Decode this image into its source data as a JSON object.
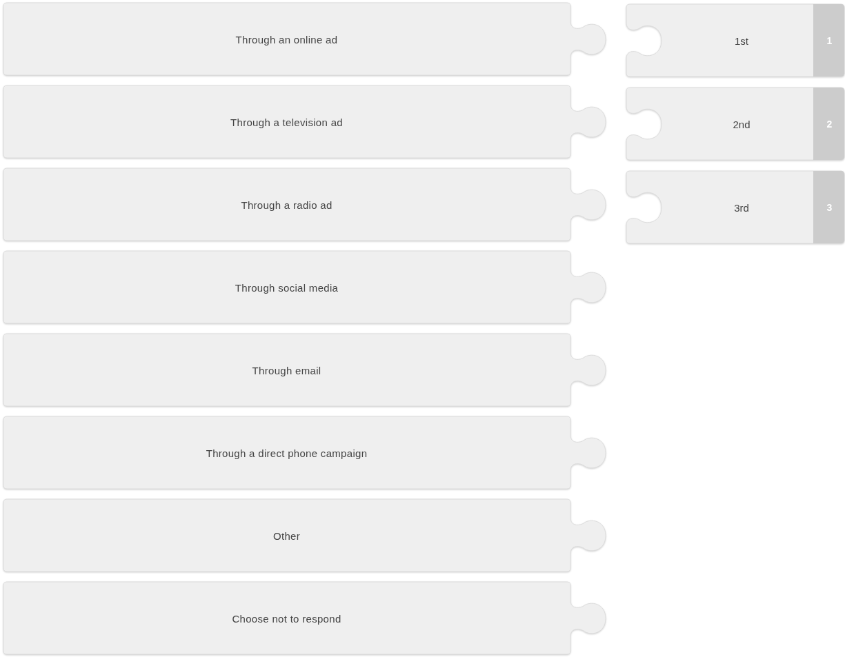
{
  "pieces": [
    {
      "label": "Through an online ad"
    },
    {
      "label": "Through a television ad"
    },
    {
      "label": "Through a radio ad"
    },
    {
      "label": "Through social media"
    },
    {
      "label": "Through email"
    },
    {
      "label": "Through a direct phone campaign"
    },
    {
      "label": "Other"
    },
    {
      "label": "Choose not to respond"
    }
  ],
  "slots": [
    {
      "label": "1st",
      "number": "1"
    },
    {
      "label": "2nd",
      "number": "2"
    },
    {
      "label": "3rd",
      "number": "3"
    }
  ]
}
